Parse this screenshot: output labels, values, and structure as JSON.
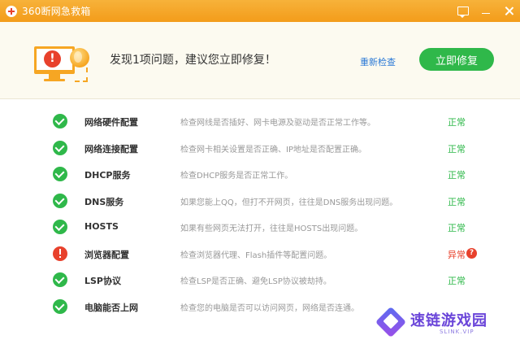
{
  "window": {
    "title": "360断网急救箱",
    "icons": [
      "message-icon",
      "minimize-icon",
      "close-icon"
    ]
  },
  "header": {
    "message": "发现1项问题，建议您立即修复！",
    "recheck_label": "重新检查",
    "fix_label": "立即修复"
  },
  "checks": [
    {
      "name": "网络硬件配置",
      "desc": "检查网线是否插好、网卡电源及驱动是否正常工作等。",
      "status": "正常",
      "state": "ok"
    },
    {
      "name": "网络连接配置",
      "desc": "检查网卡相关设置是否正确、IP地址是否配置正确。",
      "status": "正常",
      "state": "ok"
    },
    {
      "name": "DHCP服务",
      "desc": "检查DHCP服务是否正常工作。",
      "status": "正常",
      "state": "ok"
    },
    {
      "name": "DNS服务",
      "desc": "如果您能上QQ，但打不开网页，往往是DNS服务出现问题。",
      "status": "正常",
      "state": "ok"
    },
    {
      "name": "HOSTS",
      "desc": "如果有些网页无法打开，往往是HOSTS出现问题。",
      "status": "正常",
      "state": "ok"
    },
    {
      "name": "浏览器配置",
      "desc": "检查浏览器代理、Flash插件等配置问题。",
      "status": "异常",
      "state": "err"
    },
    {
      "name": "LSP协议",
      "desc": "检查LSP是否正确、避免LSP协议被劫持。",
      "status": "正常",
      "state": "ok"
    },
    {
      "name": "电脑能否上网",
      "desc": "检查您的电脑是否可以访问网页，网络是否连通。",
      "status": "",
      "state": "ok"
    }
  ],
  "watermark": {
    "name": "速链游戏园",
    "domain": "SLINK.VIP"
  },
  "colors": {
    "accent": "#f5a623",
    "ok": "#2fb84a",
    "error": "#e8412c",
    "link": "#2b79d6"
  }
}
